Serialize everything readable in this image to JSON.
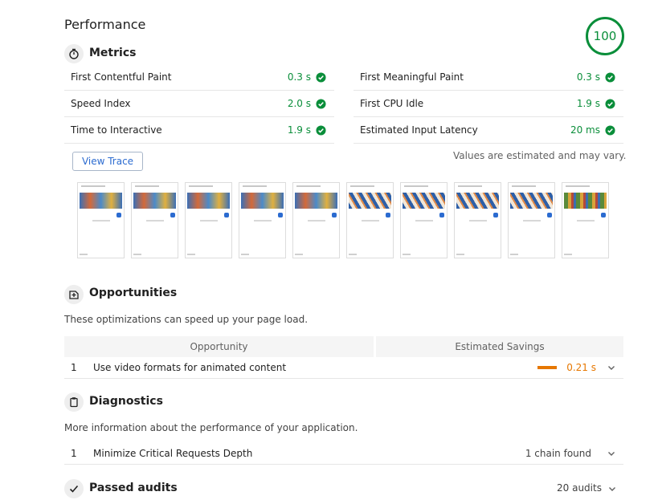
{
  "header": {
    "title": "Performance",
    "score": "100"
  },
  "metrics": {
    "title": "Metrics",
    "items": [
      {
        "label": "First Contentful Paint",
        "value": "0.3 s"
      },
      {
        "label": "First Meaningful Paint",
        "value": "0.3 s"
      },
      {
        "label": "Speed Index",
        "value": "2.0 s"
      },
      {
        "label": "First CPU Idle",
        "value": "1.9 s"
      },
      {
        "label": "Time to Interactive",
        "value": "1.9 s"
      },
      {
        "label": "Estimated Input Latency",
        "value": "20 ms"
      }
    ],
    "view_trace": "View Trace",
    "note": "Values are estimated and may vary."
  },
  "opportunities": {
    "title": "Opportunities",
    "description": "These optimizations can speed up your page load.",
    "col_opportunity": "Opportunity",
    "col_savings": "Estimated Savings",
    "rows": [
      {
        "index": "1",
        "label": "Use video formats for animated content",
        "savings": "0.21 s"
      }
    ]
  },
  "diagnostics": {
    "title": "Diagnostics",
    "description": "More information about the performance of your application.",
    "rows": [
      {
        "index": "1",
        "label": "Minimize Critical Requests Depth",
        "detail": "1 chain found"
      }
    ]
  },
  "passed": {
    "title": "Passed audits",
    "count": "20 audits"
  },
  "colors": {
    "pass": "#0a8e3a",
    "average": "#e67700",
    "link": "#2b6bd0"
  }
}
